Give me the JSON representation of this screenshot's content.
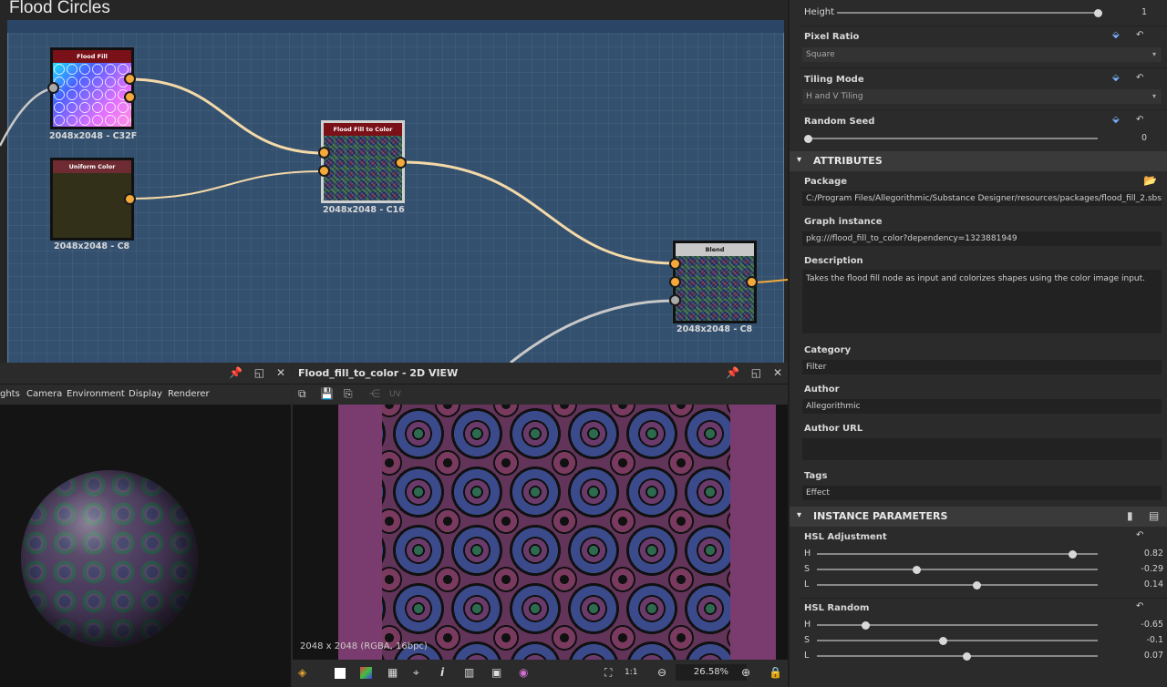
{
  "graph": {
    "title": "Flood Circles",
    "nodes": [
      {
        "name": "Flood Fill",
        "res": "2048x2048 - C32F"
      },
      {
        "name": "Uniform Color",
        "res": "2048x2048 - C8"
      },
      {
        "name": "Flood Fill to Color",
        "res": "2048x2048 - C16"
      },
      {
        "name": "Blend",
        "res": "2048x2048 - C8"
      }
    ]
  },
  "view3d": {
    "menu": [
      "ghts",
      "Camera",
      "Environment",
      "Display",
      "Renderer"
    ],
    "buttons": [
      "📌",
      "◱",
      "✕"
    ]
  },
  "view2d": {
    "title": "Flood_fill_to_color - 2D VIEW",
    "uv_label": "UV",
    "resolution": "2048 x 2048 (RGBA, 16bpc)",
    "zoom": "26.58%",
    "buttons": [
      "📌",
      "◱",
      "✕"
    ]
  },
  "properties": {
    "height": {
      "label": "Height",
      "value": "1",
      "level": 1.0
    },
    "pixel_ratio": {
      "label": "Pixel Ratio",
      "value": "Square"
    },
    "tiling_mode": {
      "label": "Tiling Mode",
      "value": "H and V Tiling"
    },
    "random_seed": {
      "label": "Random Seed",
      "value": "0",
      "level": 0.0
    },
    "attributes_title": "ATTRIBUTES",
    "package": {
      "label": "Package",
      "value": "C:/Program Files/Allegorithmic/Substance Designer/resources/packages/flood_fill_2.sbs"
    },
    "graph_instance": {
      "label": "Graph instance",
      "value": "pkg:///flood_fill_to_color?dependency=1323881949"
    },
    "description": {
      "label": "Description",
      "value": "Takes the flood fill node as input and colorizes shapes using the color image input."
    },
    "category": {
      "label": "Category",
      "value": "Filter"
    },
    "author": {
      "label": "Author",
      "value": "Allegorithmic"
    },
    "author_url": {
      "label": "Author URL",
      "value": ""
    },
    "tags": {
      "label": "Tags",
      "value": "Effect"
    },
    "instance_title": "INSTANCE PARAMETERS",
    "hsl_adjustment": {
      "label": "HSL Adjustment",
      "rows": [
        {
          "key": "H",
          "value": "0.82",
          "level": 0.91
        },
        {
          "key": "S",
          "value": "-0.29",
          "level": 0.355
        },
        {
          "key": "L",
          "value": "0.14",
          "level": 0.57
        }
      ]
    },
    "hsl_random": {
      "label": "HSL Random",
      "rows": [
        {
          "key": "H",
          "value": "-0.65",
          "level": 0.175
        },
        {
          "key": "S",
          "value": "-0.1",
          "level": 0.45
        },
        {
          "key": "L",
          "value": "0.07",
          "level": 0.535
        }
      ]
    }
  }
}
